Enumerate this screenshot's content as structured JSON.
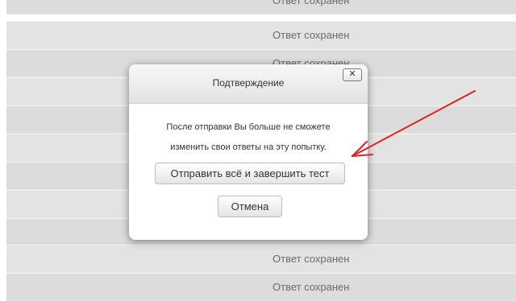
{
  "background": {
    "rows": [
      {
        "status": "Ответ сохранен"
      },
      {
        "status": "Ответ сохранен"
      },
      {
        "status": "Ответ сохранен"
      },
      {
        "status": ""
      },
      {
        "status": ""
      },
      {
        "status": ""
      },
      {
        "status": ""
      },
      {
        "status": ""
      },
      {
        "status": ""
      },
      {
        "status": "Ответ сохранен"
      },
      {
        "status": "Ответ сохранен"
      }
    ]
  },
  "dialog": {
    "title": "Подтверждение",
    "close_label": "✕",
    "message_line1": "После отправки Вы больше не сможете",
    "message_line2": "изменить свои ответы на эту попытку.",
    "submit_label": "Отправить всё и завершить тест",
    "cancel_label": "Отмена"
  },
  "annotation": {
    "arrow_color": "#e02020"
  }
}
